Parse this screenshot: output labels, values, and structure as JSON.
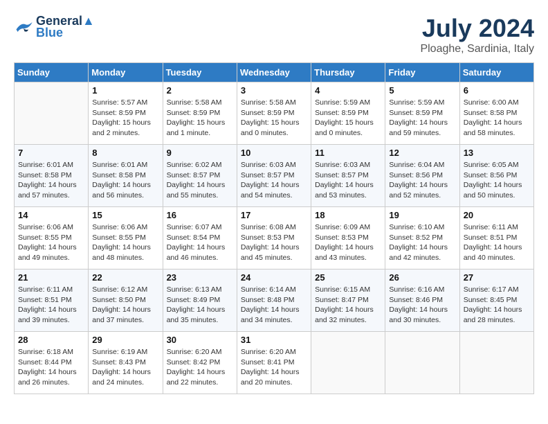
{
  "header": {
    "logo_line1": "General",
    "logo_line2": "Blue",
    "month": "July 2024",
    "location": "Ploaghe, Sardinia, Italy"
  },
  "columns": [
    "Sunday",
    "Monday",
    "Tuesday",
    "Wednesday",
    "Thursday",
    "Friday",
    "Saturday"
  ],
  "weeks": [
    [
      {
        "day": "",
        "info": ""
      },
      {
        "day": "1",
        "info": "Sunrise: 5:57 AM\nSunset: 8:59 PM\nDaylight: 15 hours\nand 2 minutes."
      },
      {
        "day": "2",
        "info": "Sunrise: 5:58 AM\nSunset: 8:59 PM\nDaylight: 15 hours\nand 1 minute."
      },
      {
        "day": "3",
        "info": "Sunrise: 5:58 AM\nSunset: 8:59 PM\nDaylight: 15 hours\nand 0 minutes."
      },
      {
        "day": "4",
        "info": "Sunrise: 5:59 AM\nSunset: 8:59 PM\nDaylight: 15 hours\nand 0 minutes."
      },
      {
        "day": "5",
        "info": "Sunrise: 5:59 AM\nSunset: 8:59 PM\nDaylight: 14 hours\nand 59 minutes."
      },
      {
        "day": "6",
        "info": "Sunrise: 6:00 AM\nSunset: 8:58 PM\nDaylight: 14 hours\nand 58 minutes."
      }
    ],
    [
      {
        "day": "7",
        "info": "Sunrise: 6:01 AM\nSunset: 8:58 PM\nDaylight: 14 hours\nand 57 minutes."
      },
      {
        "day": "8",
        "info": "Sunrise: 6:01 AM\nSunset: 8:58 PM\nDaylight: 14 hours\nand 56 minutes."
      },
      {
        "day": "9",
        "info": "Sunrise: 6:02 AM\nSunset: 8:57 PM\nDaylight: 14 hours\nand 55 minutes."
      },
      {
        "day": "10",
        "info": "Sunrise: 6:03 AM\nSunset: 8:57 PM\nDaylight: 14 hours\nand 54 minutes."
      },
      {
        "day": "11",
        "info": "Sunrise: 6:03 AM\nSunset: 8:57 PM\nDaylight: 14 hours\nand 53 minutes."
      },
      {
        "day": "12",
        "info": "Sunrise: 6:04 AM\nSunset: 8:56 PM\nDaylight: 14 hours\nand 52 minutes."
      },
      {
        "day": "13",
        "info": "Sunrise: 6:05 AM\nSunset: 8:56 PM\nDaylight: 14 hours\nand 50 minutes."
      }
    ],
    [
      {
        "day": "14",
        "info": "Sunrise: 6:06 AM\nSunset: 8:55 PM\nDaylight: 14 hours\nand 49 minutes."
      },
      {
        "day": "15",
        "info": "Sunrise: 6:06 AM\nSunset: 8:55 PM\nDaylight: 14 hours\nand 48 minutes."
      },
      {
        "day": "16",
        "info": "Sunrise: 6:07 AM\nSunset: 8:54 PM\nDaylight: 14 hours\nand 46 minutes."
      },
      {
        "day": "17",
        "info": "Sunrise: 6:08 AM\nSunset: 8:53 PM\nDaylight: 14 hours\nand 45 minutes."
      },
      {
        "day": "18",
        "info": "Sunrise: 6:09 AM\nSunset: 8:53 PM\nDaylight: 14 hours\nand 43 minutes."
      },
      {
        "day": "19",
        "info": "Sunrise: 6:10 AM\nSunset: 8:52 PM\nDaylight: 14 hours\nand 42 minutes."
      },
      {
        "day": "20",
        "info": "Sunrise: 6:11 AM\nSunset: 8:51 PM\nDaylight: 14 hours\nand 40 minutes."
      }
    ],
    [
      {
        "day": "21",
        "info": "Sunrise: 6:11 AM\nSunset: 8:51 PM\nDaylight: 14 hours\nand 39 minutes."
      },
      {
        "day": "22",
        "info": "Sunrise: 6:12 AM\nSunset: 8:50 PM\nDaylight: 14 hours\nand 37 minutes."
      },
      {
        "day": "23",
        "info": "Sunrise: 6:13 AM\nSunset: 8:49 PM\nDaylight: 14 hours\nand 35 minutes."
      },
      {
        "day": "24",
        "info": "Sunrise: 6:14 AM\nSunset: 8:48 PM\nDaylight: 14 hours\nand 34 minutes."
      },
      {
        "day": "25",
        "info": "Sunrise: 6:15 AM\nSunset: 8:47 PM\nDaylight: 14 hours\nand 32 minutes."
      },
      {
        "day": "26",
        "info": "Sunrise: 6:16 AM\nSunset: 8:46 PM\nDaylight: 14 hours\nand 30 minutes."
      },
      {
        "day": "27",
        "info": "Sunrise: 6:17 AM\nSunset: 8:45 PM\nDaylight: 14 hours\nand 28 minutes."
      }
    ],
    [
      {
        "day": "28",
        "info": "Sunrise: 6:18 AM\nSunset: 8:44 PM\nDaylight: 14 hours\nand 26 minutes."
      },
      {
        "day": "29",
        "info": "Sunrise: 6:19 AM\nSunset: 8:43 PM\nDaylight: 14 hours\nand 24 minutes."
      },
      {
        "day": "30",
        "info": "Sunrise: 6:20 AM\nSunset: 8:42 PM\nDaylight: 14 hours\nand 22 minutes."
      },
      {
        "day": "31",
        "info": "Sunrise: 6:20 AM\nSunset: 8:41 PM\nDaylight: 14 hours\nand 20 minutes."
      },
      {
        "day": "",
        "info": ""
      },
      {
        "day": "",
        "info": ""
      },
      {
        "day": "",
        "info": ""
      }
    ]
  ]
}
